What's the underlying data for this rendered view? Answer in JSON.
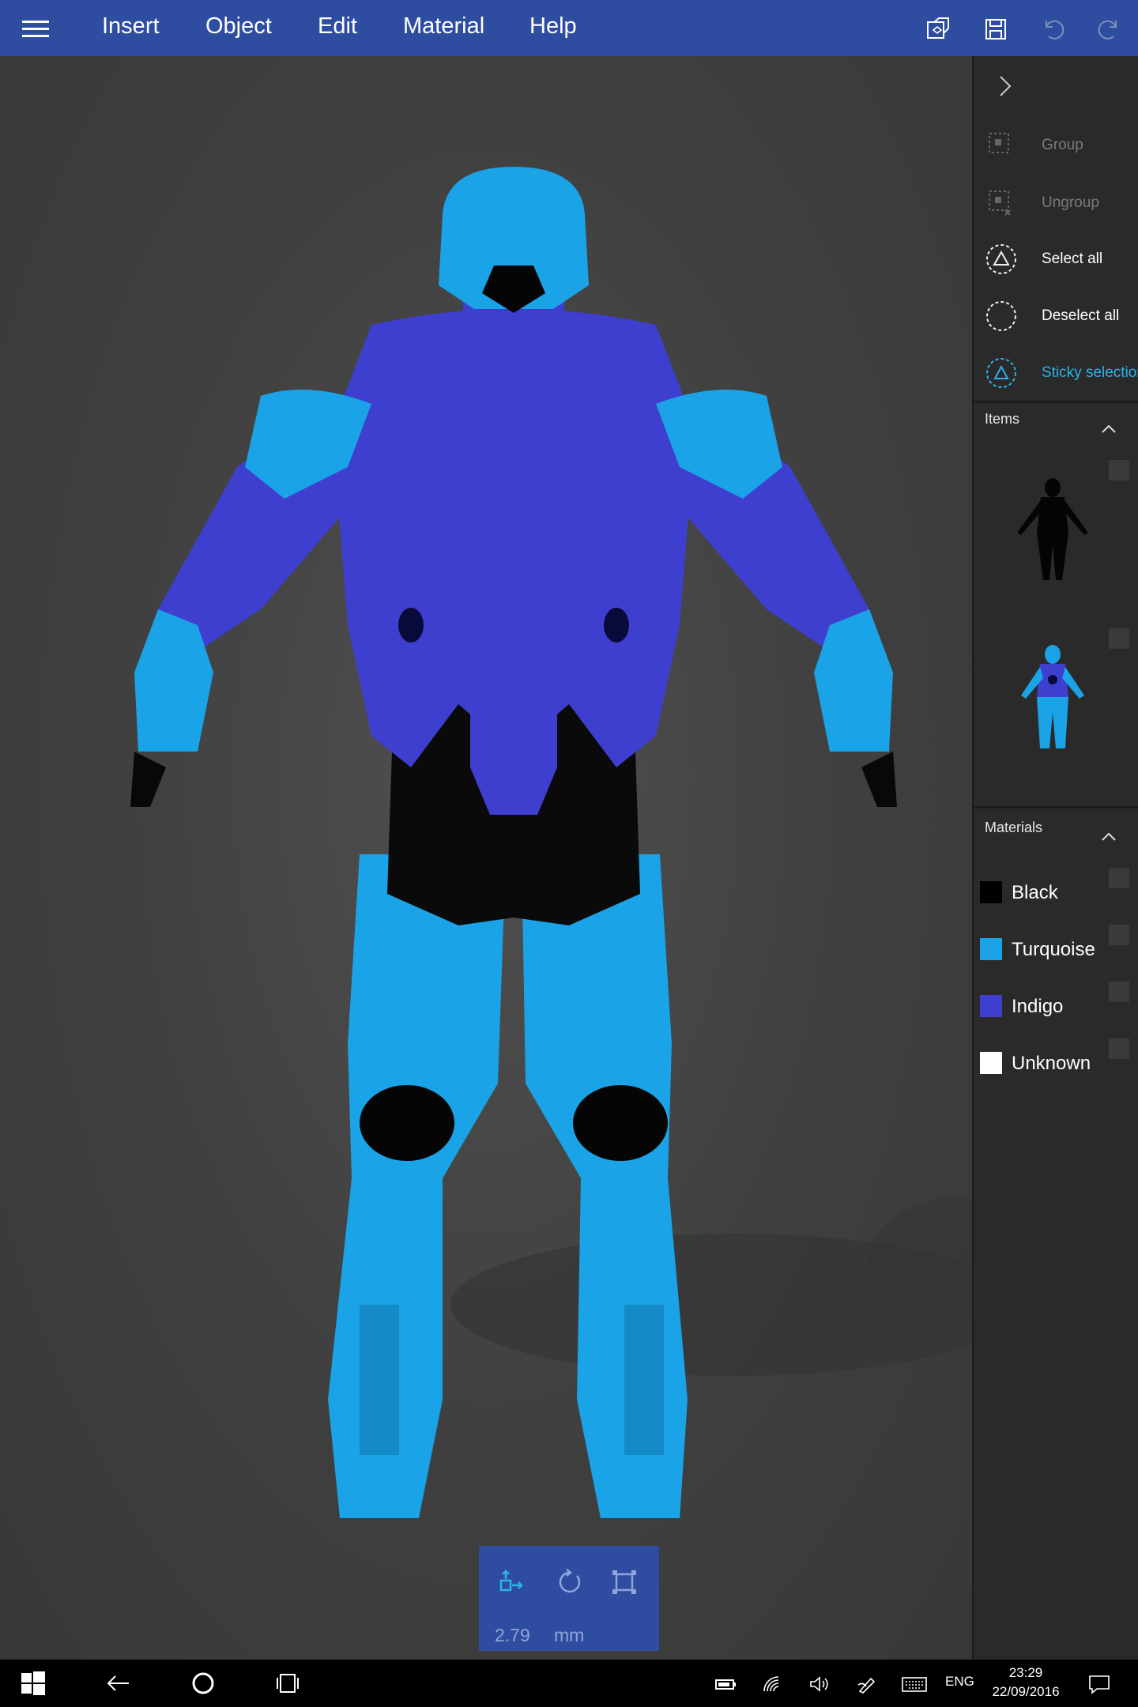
{
  "menu": {
    "items": [
      "Insert",
      "Object",
      "Edit",
      "Material",
      "Help"
    ],
    "icons": [
      "3d-view-icon",
      "save-icon",
      "undo-icon",
      "redo-icon"
    ]
  },
  "panel": {
    "actions": [
      {
        "label": "Group",
        "state": "disabled",
        "icon": "group-icon"
      },
      {
        "label": "Ungroup",
        "state": "disabled",
        "icon": "ungroup-icon"
      },
      {
        "label": "Select all",
        "state": "enabled",
        "icon": "select-all-icon"
      },
      {
        "label": "Deselect all",
        "state": "enabled",
        "icon": "deselect-all-icon"
      },
      {
        "label": "Sticky selection",
        "state": "active",
        "icon": "sticky-selection-icon"
      }
    ],
    "items_header": "Items",
    "materials_header": "Materials",
    "materials": [
      {
        "label": "Black",
        "color": "#000000"
      },
      {
        "label": "Turquoise",
        "color": "#1aa3e6"
      },
      {
        "label": "Indigo",
        "color": "#3f3fcf"
      },
      {
        "label": "Unknown",
        "color": "#ffffff"
      }
    ]
  },
  "transform": {
    "value": "2.79",
    "unit": "mm"
  },
  "taskbar": {
    "language": "ENG",
    "time": "23:29",
    "date": "22/09/2016"
  },
  "colors": {
    "menubar": "#2f4da0",
    "accent": "#2bb3ea",
    "turquoise": "#1aa3e6",
    "indigo": "#3f3fcf"
  }
}
